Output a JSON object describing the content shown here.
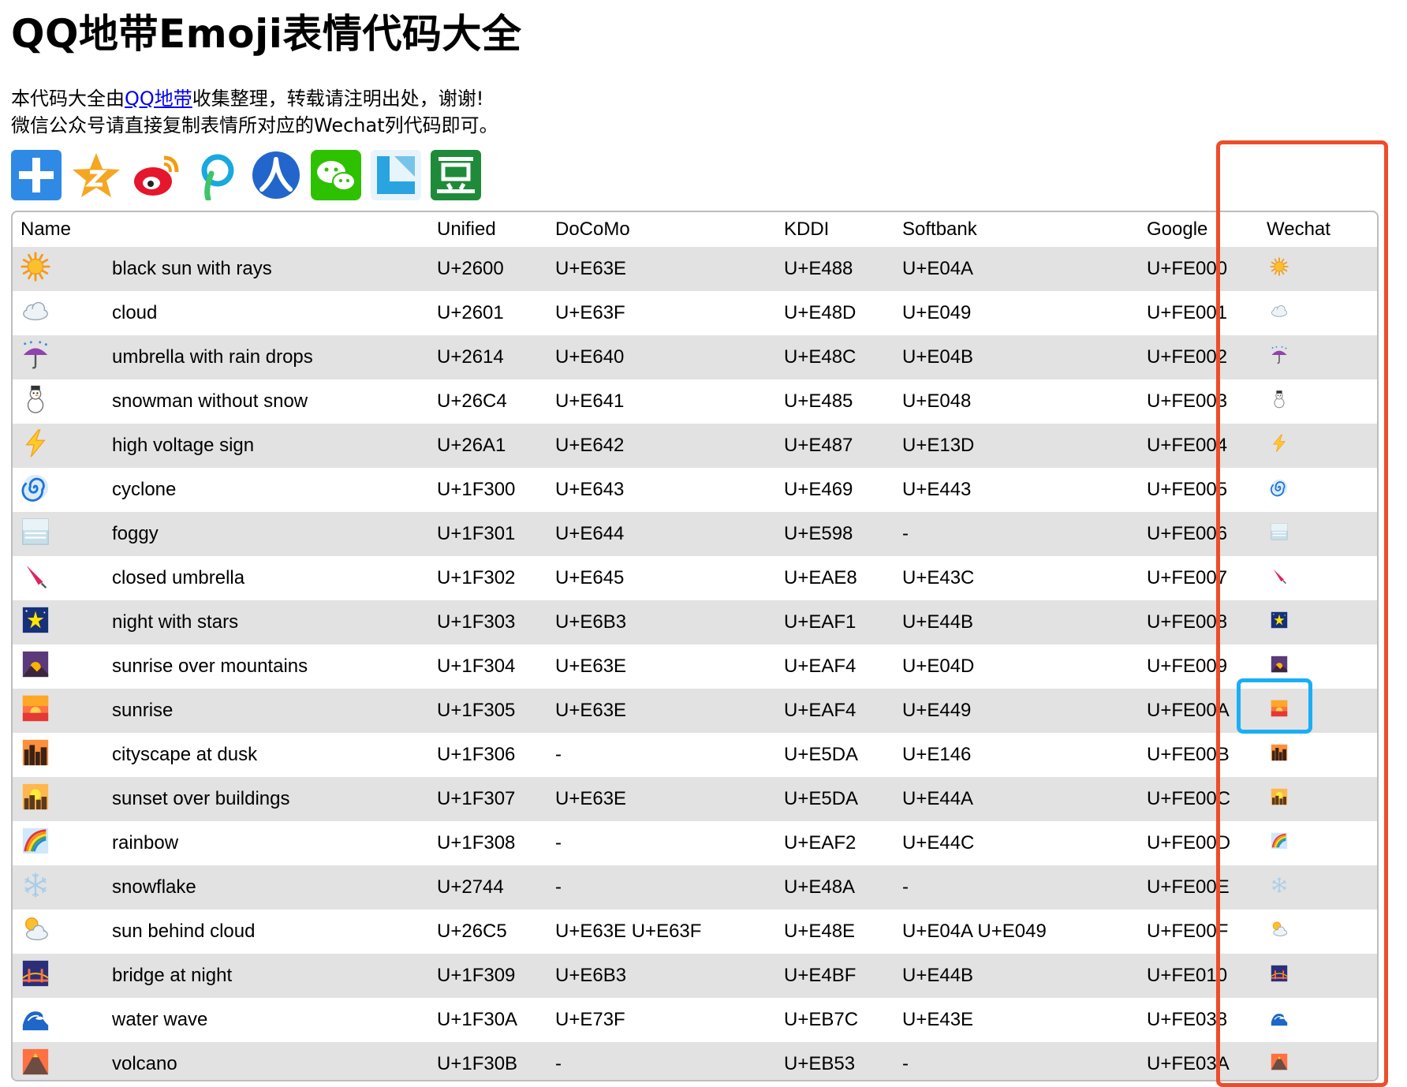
{
  "page": {
    "title": "QQ地带Emoji表情代码大全",
    "intro_prefix": "本代码大全由",
    "intro_link": "QQ地带",
    "intro_suffix": "收集整理，转载请注明出处，谢谢!",
    "intro_line2": "微信公众号请直接复制表情所对应的Wechat列代码即可。"
  },
  "share_icons": [
    {
      "name": "qzone-add",
      "color": "#2f8ae5"
    },
    {
      "name": "qzone-star",
      "color": "#f5a623"
    },
    {
      "name": "weibo",
      "color": "#e6162d"
    },
    {
      "name": "tencent-weibo",
      "color": "#19a8df"
    },
    {
      "name": "renren",
      "color": "#2266cc"
    },
    {
      "name": "wechat",
      "color": "#2dc100"
    },
    {
      "name": "kaixin",
      "color": "#2aa4e0"
    },
    {
      "name": "douban",
      "color": "#1f8b3a"
    }
  ],
  "table": {
    "headers": {
      "name": "Name",
      "unified": "Unified",
      "docomo": "DoCoMo",
      "kddi": "KDDI",
      "softbank": "Softbank",
      "google": "Google",
      "wechat": "Wechat"
    },
    "rows": [
      {
        "icon": "sun-icon",
        "name": "black sun with rays",
        "unified": "U+2600",
        "docomo": "U+E63E",
        "kddi": "U+E488",
        "softbank": "U+E04A",
        "google": "U+FE000",
        "wechat_glyph": "☀"
      },
      {
        "icon": "cloud-icon",
        "name": "cloud",
        "unified": "U+2601",
        "docomo": "U+E63F",
        "kddi": "U+E48D",
        "softbank": "U+E049",
        "google": "U+FE001",
        "wechat_glyph": "☁"
      },
      {
        "icon": "umbrella-rain-icon",
        "name": "umbrella with rain drops",
        "unified": "U+2614",
        "docomo": "U+E640",
        "kddi": "U+E48C",
        "softbank": "U+E04B",
        "google": "U+FE002",
        "wechat_glyph": ""
      },
      {
        "icon": "snowman-icon",
        "name": "snowman without snow",
        "unified": "U+26C4",
        "docomo": "U+E641",
        "kddi": "U+E485",
        "softbank": "U+E048",
        "google": "U+FE003",
        "wechat_glyph": ""
      },
      {
        "icon": "lightning-icon",
        "name": "high voltage sign",
        "unified": "U+26A1",
        "docomo": "U+E642",
        "kddi": "U+E487",
        "softbank": "U+E13D",
        "google": "U+FE004",
        "wechat_glyph": ""
      },
      {
        "icon": "cyclone-icon",
        "name": "cyclone",
        "unified": "U+1F300",
        "docomo": "U+E643",
        "kddi": "U+E469",
        "softbank": "U+E443",
        "google": "U+FE005",
        "wechat_glyph": ""
      },
      {
        "icon": "foggy-icon",
        "name": "foggy",
        "unified": "U+1F301",
        "docomo": "U+E644",
        "kddi": "U+E598",
        "softbank": "-",
        "google": "U+FE006",
        "wechat_glyph": ""
      },
      {
        "icon": "closed-umbrella-icon",
        "name": "closed umbrella",
        "unified": "U+1F302",
        "docomo": "U+E645",
        "kddi": "U+EAE8",
        "softbank": "U+E43C",
        "google": "U+FE007",
        "wechat_glyph": ""
      },
      {
        "icon": "night-stars-icon",
        "name": "night with stars",
        "unified": "U+1F303",
        "docomo": "U+E6B3",
        "kddi": "U+EAF1",
        "softbank": "U+E44B",
        "google": "U+FE008",
        "wechat_glyph": ""
      },
      {
        "icon": "sunrise-mountains-icon",
        "name": "sunrise over mountains",
        "unified": "U+1F304",
        "docomo": "U+E63E",
        "kddi": "U+EAF4",
        "softbank": "U+E04D",
        "google": "U+FE009",
        "wechat_glyph": ""
      },
      {
        "icon": "sunrise-icon",
        "name": "sunrise",
        "unified": "U+1F305",
        "docomo": "U+E63E",
        "kddi": "U+EAF4",
        "softbank": "U+E449",
        "google": "U+FE00A",
        "wechat_glyph": ""
      },
      {
        "icon": "cityscape-dusk-icon",
        "name": "cityscape at dusk",
        "unified": "U+1F306",
        "docomo": "-",
        "kddi": "U+E5DA",
        "softbank": "U+E146",
        "google": "U+FE00B",
        "wechat_glyph": ""
      },
      {
        "icon": "sunset-buildings-icon",
        "name": "sunset over buildings",
        "unified": "U+1F307",
        "docomo": "U+E63E",
        "kddi": "U+E5DA",
        "softbank": "U+E44A",
        "google": "U+FE00C",
        "wechat_glyph": ""
      },
      {
        "icon": "rainbow-icon",
        "name": "rainbow",
        "unified": "U+1F308",
        "docomo": "-",
        "kddi": "U+EAF2",
        "softbank": "U+E44C",
        "google": "U+FE00D",
        "wechat_glyph": ""
      },
      {
        "icon": "snowflake-icon",
        "name": "snowflake",
        "unified": "U+2744",
        "docomo": "-",
        "kddi": "U+E48A",
        "softbank": "-",
        "google": "U+FE00E",
        "wechat_glyph": "❄"
      },
      {
        "icon": "sun-behind-cloud-icon",
        "name": "sun behind cloud",
        "unified": "U+26C5",
        "docomo": "U+E63E U+E63F",
        "kddi": "U+E48E",
        "softbank": "U+E04A U+E049",
        "google": "U+FE00F",
        "wechat_glyph": ""
      },
      {
        "icon": "bridge-night-icon",
        "name": "bridge at night",
        "unified": "U+1F309",
        "docomo": "U+E6B3",
        "kddi": "U+E4BF",
        "softbank": "U+E44B",
        "google": "U+FE010",
        "wechat_glyph": ""
      },
      {
        "icon": "water-wave-icon",
        "name": "water wave",
        "unified": "U+1F30A",
        "docomo": "U+E73F",
        "kddi": "U+EB7C",
        "softbank": "U+E43E",
        "google": "U+FE038",
        "wechat_glyph": ""
      },
      {
        "icon": "volcano-icon",
        "name": "volcano",
        "unified": "U+1F30B",
        "docomo": "-",
        "kddi": "U+EB53",
        "softbank": "-",
        "google": "U+FE03A",
        "wechat_glyph": ""
      }
    ]
  },
  "annotation_colors": {
    "red_box": "#ee4d2a",
    "blue_box": "#1aaef5"
  }
}
